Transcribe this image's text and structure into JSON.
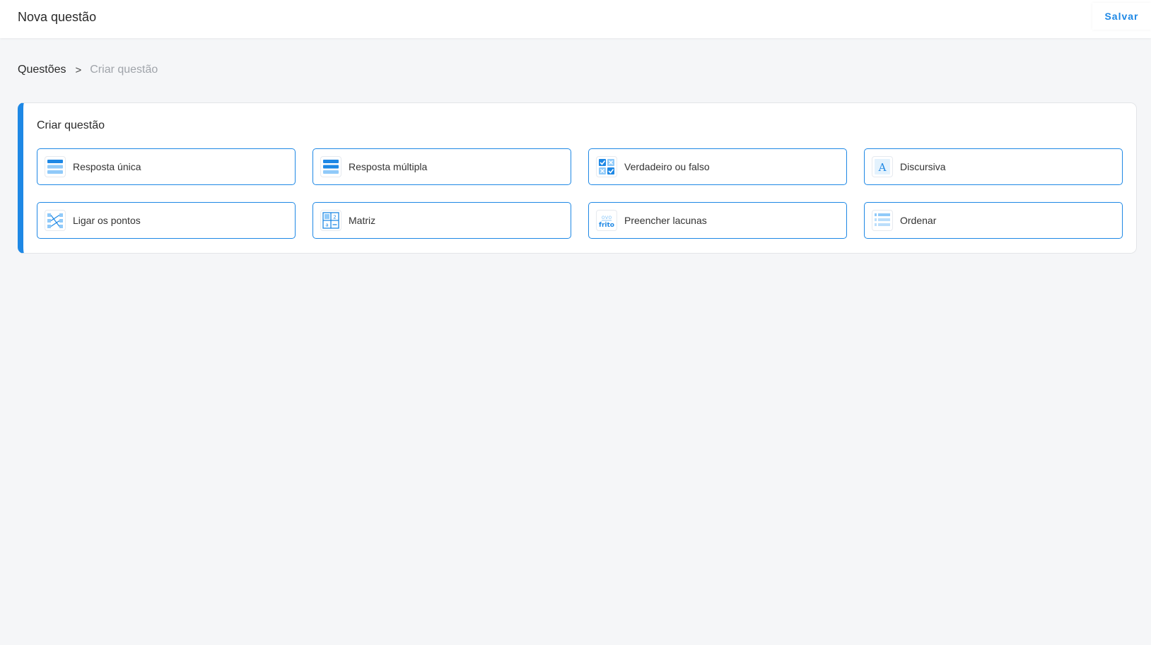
{
  "header": {
    "title": "Nova questão",
    "save_label": "Salvar"
  },
  "breadcrumb": {
    "parent": "Questões",
    "separator": ">",
    "current": "Criar questão"
  },
  "card": {
    "title": "Criar questão",
    "options": [
      {
        "label": "Resposta única",
        "icon": "single-answer-icon"
      },
      {
        "label": "Resposta múltipla",
        "icon": "multiple-answer-icon"
      },
      {
        "label": "Verdadeiro ou falso",
        "icon": "true-false-icon"
      },
      {
        "label": "Discursiva",
        "icon": "essay-icon"
      },
      {
        "label": "Ligar os pontos",
        "icon": "connect-dots-icon"
      },
      {
        "label": "Matriz",
        "icon": "matrix-icon"
      },
      {
        "label": "Preencher lacunas",
        "icon": "fill-blanks-icon"
      },
      {
        "label": "Ordenar",
        "icon": "ordering-icon"
      }
    ],
    "icon_text": {
      "essay": "A",
      "fill_blanks_top": "ovo",
      "fill_blanks_bottom": "frito",
      "matrix_num": "2",
      "matrix_letter": "a"
    }
  },
  "colors": {
    "accent": "#1e88e5",
    "accent_light": "#90caf9",
    "background": "#f5f6f8"
  }
}
